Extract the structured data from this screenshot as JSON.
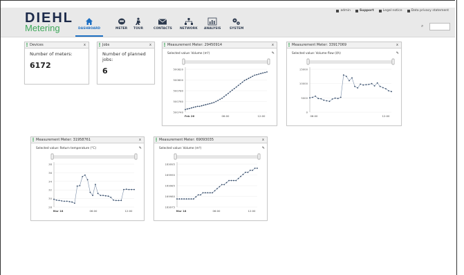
{
  "brand": {
    "name": "DIEHL",
    "sub": "Metering"
  },
  "toplinks": {
    "user": "admin",
    "support": "Support",
    "legal": "Legal notice",
    "privacy": "Data privacy statement"
  },
  "nav": [
    {
      "label": "DASHBOARD",
      "icon": "home-icon"
    },
    {
      "label": "METER",
      "icon": "meter-icon"
    },
    {
      "label": "TOUR",
      "icon": "tour-icon"
    },
    {
      "label": "CONTACTS",
      "icon": "mail-icon"
    },
    {
      "label": "NETWORK",
      "icon": "network-icon"
    },
    {
      "label": "ANALYSIS",
      "icon": "analysis-icon"
    },
    {
      "label": "SYSTEM",
      "icon": "gears-icon"
    }
  ],
  "widgets": {
    "devices": {
      "title": "Devices",
      "label": "Number of meters:",
      "value": "6172"
    },
    "jobs": {
      "title": "Jobs",
      "label": "Number of planned jobs:",
      "value": "6"
    },
    "m1": {
      "title": "Measurement Meter: 29450914",
      "selected": "Selected value: Volume (m³)"
    },
    "m2": {
      "title": "Measurement Meter: 33917069",
      "selected": "Selected value: Volume flow (l/h)"
    },
    "m3": {
      "title": "Measurement Meter: 31958761",
      "selected": "Selected value: Return temperature (°C)"
    },
    "m4": {
      "title": "Measurement Meter: 69093035",
      "selected": "Selected value: Volume (m³)"
    }
  },
  "chart_data": [
    {
      "type": "line",
      "yticks": [
        "500820",
        "500800",
        "500780",
        "500760",
        "500740"
      ],
      "xticks": [
        "Feb 26",
        "06:00",
        "12:00"
      ],
      "ylim": [
        500740,
        500820
      ],
      "x": [
        0,
        1,
        2,
        3,
        4,
        5,
        6,
        7,
        8,
        9,
        10,
        11,
        12,
        13,
        14,
        15,
        16,
        17,
        18,
        19,
        20,
        21,
        22,
        23,
        24,
        25,
        26,
        27,
        28,
        29,
        30,
        31,
        32,
        33,
        34,
        35,
        36,
        37,
        38,
        39,
        40
      ],
      "values": [
        500745,
        500746,
        500747,
        500748,
        500749,
        500750,
        500751,
        500751,
        500752,
        500753,
        500754,
        500755,
        500756,
        500757,
        500758,
        500760,
        500762,
        500764,
        500766,
        500769,
        500772,
        500775,
        500778,
        500781,
        500784,
        500787,
        500790,
        500793,
        500796,
        500799,
        500801,
        500803,
        500805,
        500807,
        500809,
        500810,
        500811,
        500812,
        500813,
        500814,
        500815
      ]
    },
    {
      "type": "line",
      "yticks": [
        "15000",
        "10000",
        "5000",
        "0"
      ],
      "xticks": [
        "06:00",
        "12:00"
      ],
      "ylim": [
        0,
        15000
      ],
      "x": [
        0,
        1,
        2,
        3,
        4,
        5,
        6,
        7,
        8,
        9,
        10,
        11,
        12,
        13,
        14,
        15,
        16,
        17,
        18,
        19,
        20,
        21,
        22,
        23,
        24,
        25,
        26,
        27,
        28,
        29
      ],
      "values": [
        5000,
        5200,
        5600,
        4800,
        4700,
        4200,
        4000,
        3800,
        4600,
        4900,
        4800,
        5200,
        13000,
        12500,
        11000,
        12000,
        9000,
        8500,
        9800,
        9500,
        9600,
        9700,
        10000,
        9200,
        10200,
        9000,
        8600,
        8200,
        7500,
        7200
      ]
    },
    {
      "type": "line",
      "yticks": [
        "38",
        "36",
        "34",
        "32",
        "30",
        "28"
      ],
      "xticks": [
        "Mar 18",
        "06:00",
        "12:00"
      ],
      "ylim": [
        28,
        39
      ],
      "x": [
        0,
        1,
        2,
        3,
        4,
        5,
        6,
        7,
        8,
        9,
        10,
        11,
        12,
        13,
        14,
        15,
        16,
        17,
        18,
        19,
        20,
        21,
        22,
        23,
        24,
        25,
        26,
        27,
        28,
        29,
        30,
        31
      ],
      "values": [
        30,
        29.8,
        29.7,
        29.6,
        29.5,
        29.5,
        29.4,
        29.3,
        29.0,
        33.4,
        33.5,
        35.8,
        36.2,
        35.0,
        31.8,
        31.0,
        33.8,
        31.5,
        31.0,
        31.0,
        30.9,
        30.8,
        30.5,
        29.8,
        29.7,
        29.7,
        29.7,
        32.5,
        32.6,
        32.5,
        32.5,
        32.5
      ]
    },
    {
      "type": "line",
      "yticks": [
        "169995",
        "169990",
        "169985",
        "169980",
        "169975"
      ],
      "xticks": [
        "Mar 18",
        "06:00",
        "12:00"
      ],
      "ylim": [
        169975,
        169996
      ],
      "x": [
        0,
        1,
        2,
        3,
        4,
        5,
        6,
        7,
        8,
        9,
        10,
        11,
        12,
        13,
        14,
        15,
        16,
        17,
        18,
        19,
        20,
        21,
        22,
        23,
        24,
        25,
        26,
        27,
        28,
        29,
        30,
        31,
        32,
        33,
        34
      ],
      "values": [
        169979,
        169979,
        169979,
        169979,
        169979,
        169979,
        169979,
        169979,
        169980,
        169981,
        169981,
        169982,
        169982,
        169982,
        169982,
        169982,
        169983,
        169984,
        169985,
        169986,
        169986,
        169987,
        169988,
        169988,
        169988,
        169988,
        169989,
        169990,
        169991,
        169992,
        169992,
        169993,
        169993,
        169994,
        169994
      ]
    }
  ]
}
